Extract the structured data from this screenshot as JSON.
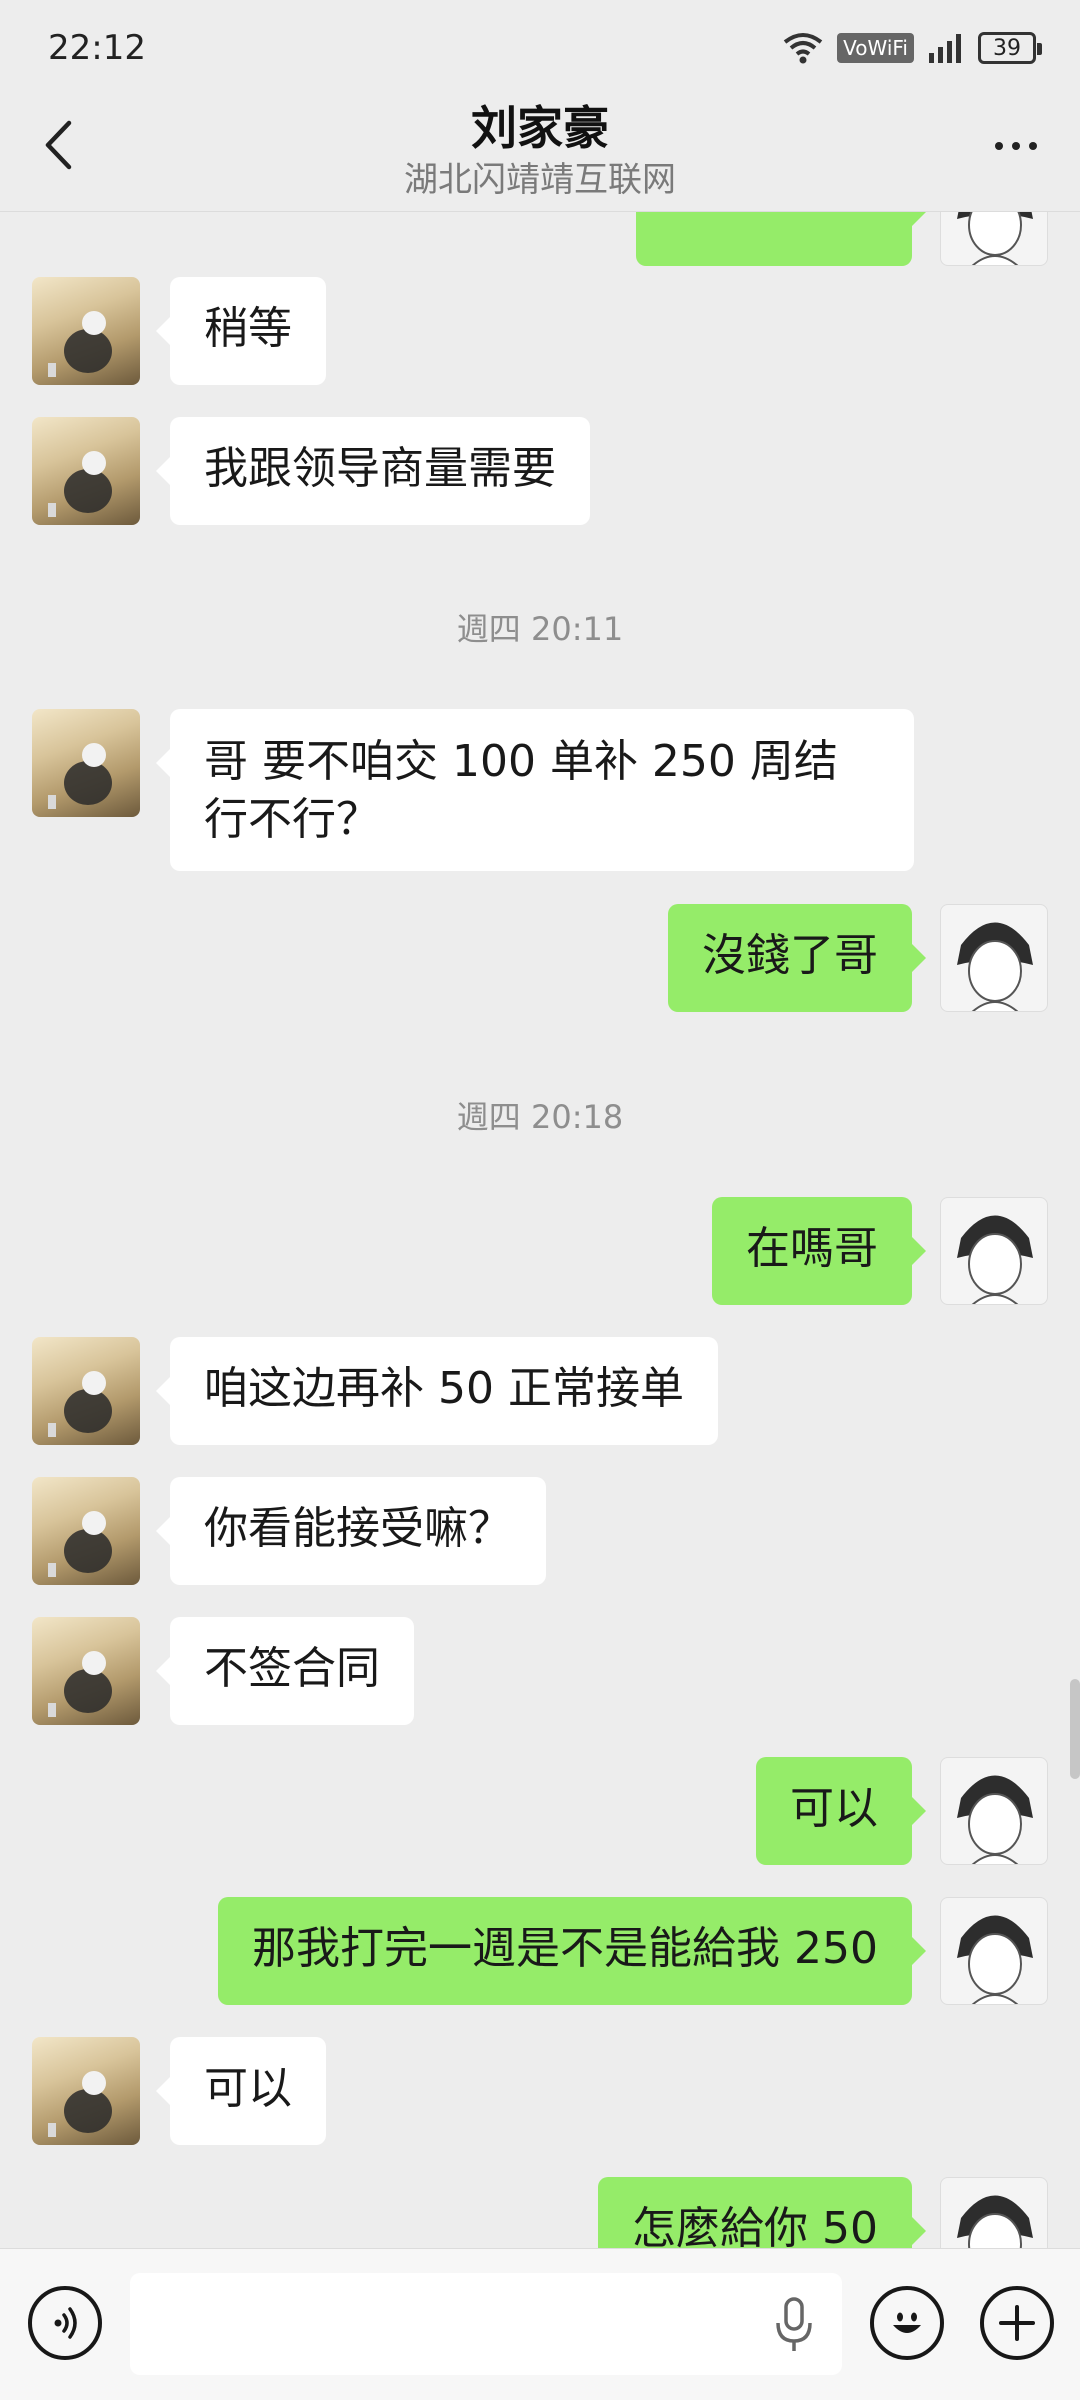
{
  "status_bar": {
    "time": "22:12",
    "network": "VoWiFi",
    "battery": "39"
  },
  "header": {
    "title": "刘家豪",
    "subtitle": "湖北闪靖靖互联网"
  },
  "messages": [
    {
      "text": "稍等"
    },
    {
      "text": "我跟领导商量需要"
    },
    {
      "text": "週四 20:11"
    },
    {
      "text": "哥 要不咱交 100 单补 250 周结行不行？"
    },
    {
      "text": "沒錢了哥"
    },
    {
      "text": "週四 20:18"
    },
    {
      "text": "在嗎哥"
    },
    {
      "text": "咱这边再补 50 正常接单"
    },
    {
      "text": "你看能接受嘛？"
    },
    {
      "text": "不签合同"
    },
    {
      "text": "可以"
    },
    {
      "text": "那我打完一週是不是能給我 250"
    },
    {
      "text": "可以"
    },
    {
      "text": "怎麼給你 50"
    }
  ],
  "colors": {
    "sent_bubble": "#95ec69",
    "received_bubble": "#ffffff",
    "background": "#ededed"
  },
  "icons": [
    "back-arrow-icon",
    "more-dots-icon",
    "voice-icon",
    "microphone-icon",
    "emoji-icon",
    "plus-icon",
    "wifi-icon",
    "signal-icon",
    "battery-icon"
  ]
}
